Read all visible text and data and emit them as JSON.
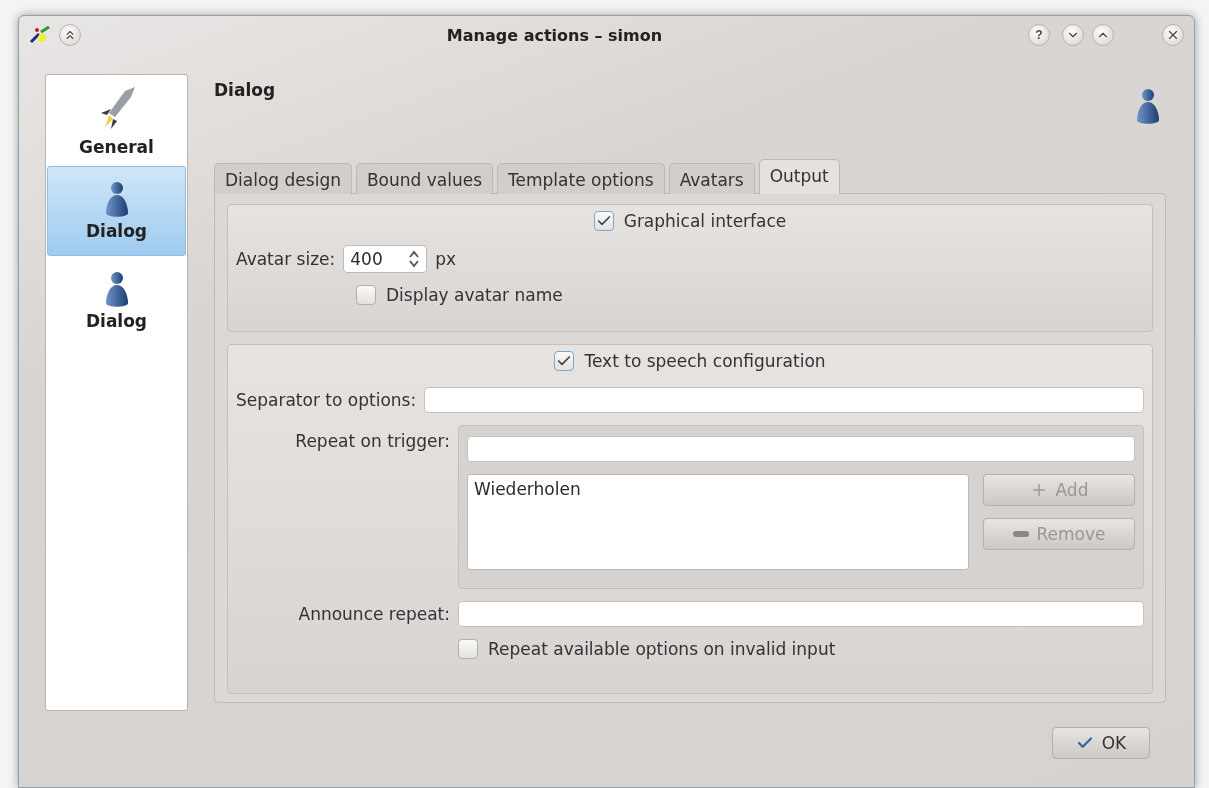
{
  "window": {
    "title": "Manage actions – simon",
    "help": "?"
  },
  "sidebar": {
    "items": [
      {
        "label": "General",
        "kind": "rocket",
        "selected": false
      },
      {
        "label": "Dialog",
        "kind": "person",
        "selected": true
      },
      {
        "label": "Dialog",
        "kind": "person",
        "selected": false
      }
    ]
  },
  "page": {
    "title": "Dialog"
  },
  "tabs": [
    {
      "label": "Dialog design",
      "selected": false
    },
    {
      "label": "Bound values",
      "selected": false
    },
    {
      "label": "Template options",
      "selected": false
    },
    {
      "label": "Avatars",
      "selected": false
    },
    {
      "label": "Output",
      "selected": true
    }
  ],
  "graphical": {
    "label": "Graphical interface",
    "checked": true
  },
  "avatar_size": {
    "label": "Avatar size:",
    "value": "400",
    "unit": "px"
  },
  "display_name": {
    "label": "Display avatar name",
    "checked": false
  },
  "tts": {
    "label": "Text to speech configuration",
    "checked": true
  },
  "separator": {
    "label": "Separator to options:"
  },
  "repeat": {
    "label": "Repeat on trigger:",
    "items": [
      "Wiederholen"
    ],
    "add": {
      "label": "Add",
      "disabled": true
    },
    "remove": {
      "label": "Remove",
      "disabled": true
    }
  },
  "announce": {
    "label": "Announce repeat:"
  },
  "repeat_invalid": {
    "label": "Repeat available options on invalid input",
    "checked": false
  },
  "ok": {
    "label": "OK"
  }
}
